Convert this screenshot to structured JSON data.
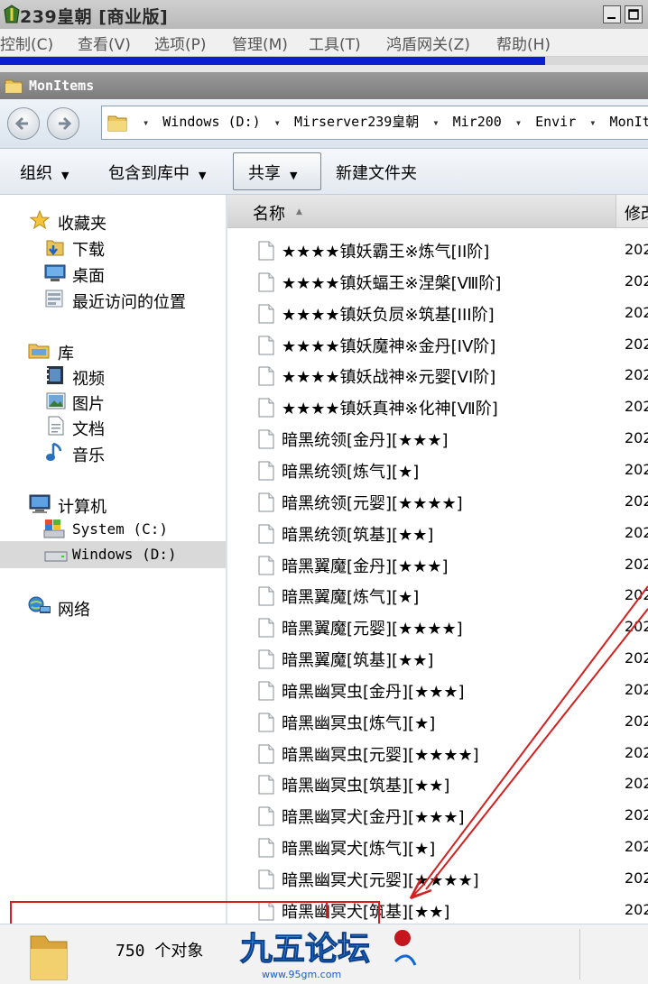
{
  "app": {
    "title": "239皇朝 [商业版]",
    "menu": [
      "控制(C)",
      "查看(V)",
      "选项(P)",
      "管理(M)",
      "工具(T)",
      "鸿盾网关(Z)",
      "帮助(H)"
    ]
  },
  "explorer": {
    "title": "MonItems",
    "breadcrumb": [
      "Windows (D:)",
      "Mirserver239皇朝",
      "Mir200",
      "Envir",
      "MonItem"
    ],
    "toolbar": {
      "organize": "组织",
      "include_in_library": "包含到库中",
      "share": "共享",
      "new_folder": "新建文件夹"
    }
  },
  "nav": {
    "favorites": {
      "label": "收藏夹",
      "items": [
        "下载",
        "桌面",
        "最近访问的位置"
      ]
    },
    "libraries": {
      "label": "库",
      "items": [
        "视频",
        "图片",
        "文档",
        "音乐"
      ]
    },
    "computer": {
      "label": "计算机",
      "items": [
        "System (C:)",
        "Windows (D:)"
      ]
    },
    "network": {
      "label": "网络"
    }
  },
  "columns": {
    "name": "名称",
    "modified": "修改"
  },
  "files": [
    {
      "name": "★★★★镇妖霸王※炼气[II阶]",
      "date": "202"
    },
    {
      "name": "★★★★镇妖蝠王※涅槃[Ⅷ阶]",
      "date": "202"
    },
    {
      "name": "★★★★镇妖负屃※筑基[III阶]",
      "date": "202"
    },
    {
      "name": "★★★★镇妖魔神※金丹[IV阶]",
      "date": "202"
    },
    {
      "name": "★★★★镇妖战神※元婴[VI阶]",
      "date": "202"
    },
    {
      "name": "★★★★镇妖真神※化神[Ⅶ阶]",
      "date": "202"
    },
    {
      "name": "暗黑统领[金丹][★★★]",
      "date": "202"
    },
    {
      "name": "暗黑统领[炼气][★]",
      "date": "202"
    },
    {
      "name": "暗黑统领[元婴][★★★★]",
      "date": "202"
    },
    {
      "name": "暗黑统领[筑基][★★]",
      "date": "202"
    },
    {
      "name": "暗黑翼魔[金丹][★★★]",
      "date": "202"
    },
    {
      "name": "暗黑翼魔[炼气][★]",
      "date": "202"
    },
    {
      "name": "暗黑翼魔[元婴][★★★★]",
      "date": "202"
    },
    {
      "name": "暗黑翼魔[筑基][★★]",
      "date": "202"
    },
    {
      "name": "暗黑幽冥虫[金丹][★★★]",
      "date": "202"
    },
    {
      "name": "暗黑幽冥虫[炼气][★]",
      "date": "202"
    },
    {
      "name": "暗黑幽冥虫[元婴][★★★★]",
      "date": "202"
    },
    {
      "name": "暗黑幽冥虫[筑基][★★]",
      "date": "202"
    },
    {
      "name": "暗黑幽冥犬[金丹][★★★]",
      "date": "202"
    },
    {
      "name": "暗黑幽冥犬[炼气][★]",
      "date": "202"
    },
    {
      "name": "暗黑幽冥犬[元婴][★★★★]",
      "date": "202"
    },
    {
      "name": "暗黑幽冥犬[筑基][★★]",
      "date": "202"
    }
  ],
  "status": {
    "count": "750 个对象"
  },
  "watermark": {
    "text": "九五论坛",
    "url": "www.95gm.com"
  },
  "colors": {
    "annotation": "#d42020",
    "selection": "#d9d9d9",
    "accent_blue": "#0a1fd0"
  }
}
